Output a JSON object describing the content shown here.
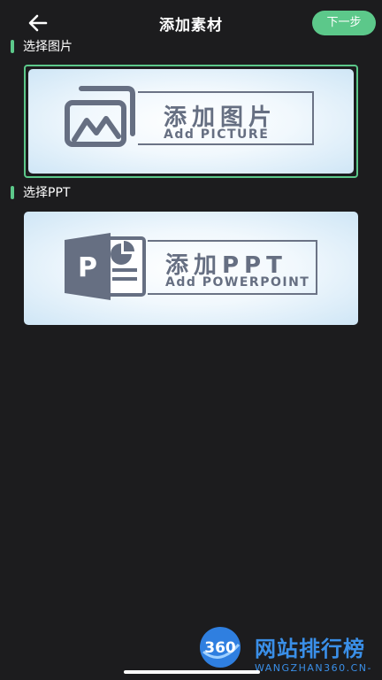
{
  "header": {
    "back_icon": "arrow-left-icon",
    "title": "添加素材",
    "next_label": "下一步"
  },
  "sections": {
    "picture": {
      "label": "选择图片",
      "card_title": "添加图片",
      "card_subtitle": "Add PICTURE",
      "card_icon": "picture-icon",
      "selected": true
    },
    "ppt": {
      "label": "选择PPT",
      "card_title": "添加PPT",
      "card_subtitle": "Add POWERPOINT",
      "card_icon": "powerpoint-icon",
      "selected": false
    }
  },
  "watermark": {
    "logo_text": "360",
    "text": "网站排行榜",
    "sub": "WANGZHAN360.CN-"
  },
  "colors": {
    "accent": "#5cc88a",
    "background": "#1c1c1e",
    "card_text": "#666f82",
    "watermark": "#3a8fe8"
  }
}
